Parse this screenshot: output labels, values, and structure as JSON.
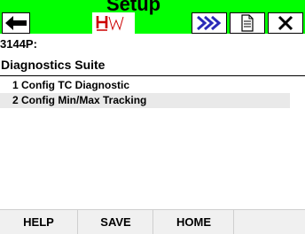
{
  "window": {
    "title": "Setup"
  },
  "toolbar": {
    "back_icon": "back-arrow-icon",
    "logo_icon": "hw-logo-icon",
    "next_icon": "fast-forward-icon",
    "doc_icon": "document-icon",
    "close_icon": "close-icon"
  },
  "header": {
    "device_tag": "3144P:",
    "menu_title": "Diagnostics Suite"
  },
  "menu": {
    "items": [
      {
        "label": "1 Config TC Diagnostic"
      },
      {
        "label": "2 Config Min/Max Tracking"
      }
    ]
  },
  "bottom": {
    "help_label": "HELP",
    "save_label": "SAVE",
    "home_label": "HOME"
  },
  "colors": {
    "top_bar": "#00ff00",
    "logo_red": "#cc0000",
    "toolbar_blue": "#2a2ab8",
    "selected_row": "#e9e9e9"
  }
}
